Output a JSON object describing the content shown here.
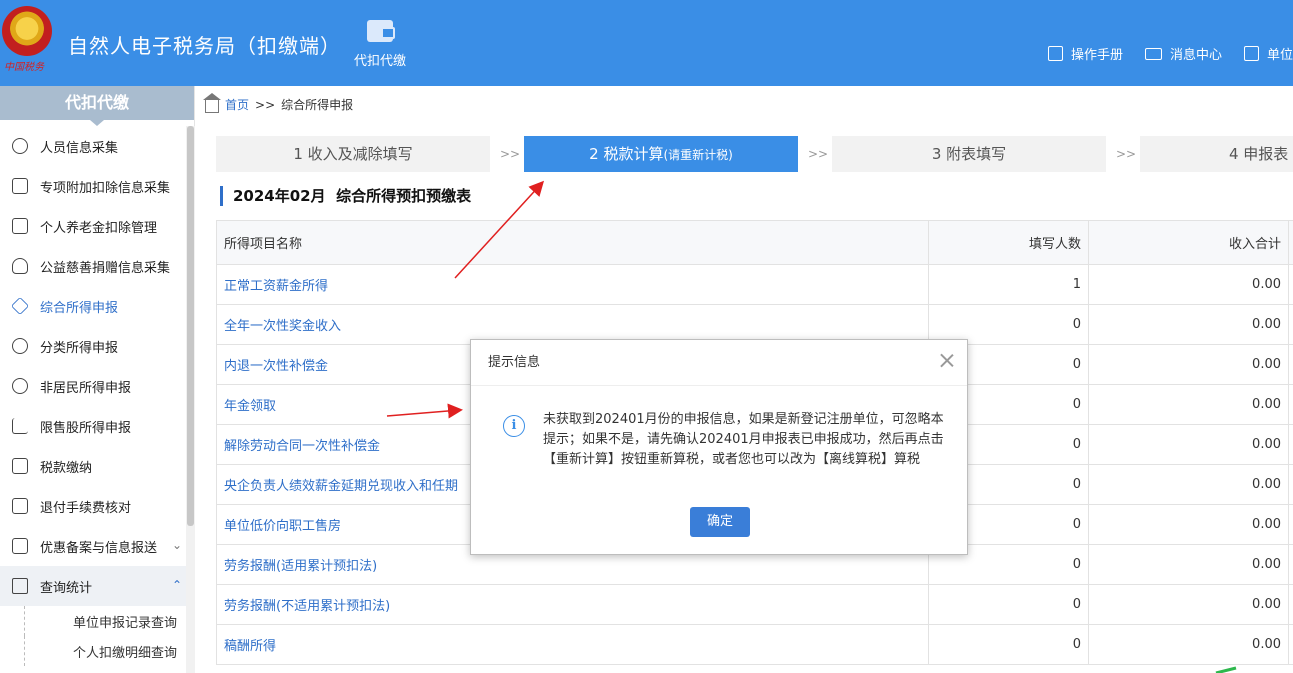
{
  "header": {
    "emblem_text": "中国税务",
    "app_title": "自然人电子税务局（扣缴端）",
    "module_label": "代扣代缴",
    "links": [
      {
        "label": "操作手册",
        "icon": "manual-icon"
      },
      {
        "label": "消息中心",
        "icon": "mail-icon"
      },
      {
        "label": "单位",
        "icon": "building-icon"
      }
    ]
  },
  "sidebar": {
    "title": "代扣代缴",
    "items": [
      {
        "label": "人员信息采集",
        "icon": "person-icon"
      },
      {
        "label": "专项附加扣除信息采集",
        "icon": "list-icon"
      },
      {
        "label": "个人养老金扣除管理",
        "icon": "pension-icon"
      },
      {
        "label": "公益慈善捐赠信息采集",
        "icon": "donation-icon"
      },
      {
        "label": "综合所得申报",
        "icon": "layers-icon"
      },
      {
        "label": "分类所得申报",
        "icon": "pie-icon"
      },
      {
        "label": "非居民所得申报",
        "icon": "user-icon"
      },
      {
        "label": "限售股所得申报",
        "icon": "bars-icon"
      },
      {
        "label": "税款缴纳",
        "icon": "wallet-icon"
      },
      {
        "label": "退付手续费核对",
        "icon": "doc-icon"
      },
      {
        "label": "优惠备案与信息报送",
        "icon": "copy-icon"
      },
      {
        "label": "查询统计",
        "icon": "search-list-icon"
      }
    ],
    "sub_items": [
      "单位申报记录查询",
      "个人扣缴明细查询"
    ]
  },
  "breadcrumb": {
    "home": "首页",
    "separator": ">>",
    "current": "综合所得申报"
  },
  "steps": [
    {
      "label": "1 收入及减除填写",
      "note": ""
    },
    {
      "label": "2 税款计算",
      "note": "(请重新计税)"
    },
    {
      "label": "3 附表填写",
      "note": ""
    },
    {
      "label": "4 申报表",
      "note": ""
    }
  ],
  "step_separator": ">>",
  "sheet": {
    "title": "2024年02月  综合所得预扣预缴表",
    "columns": [
      "所得项目名称",
      "填写人数",
      "收入合计"
    ],
    "rows": [
      {
        "name": "正常工资薪金所得",
        "count": "1",
        "income": "0.00"
      },
      {
        "name": "全年一次性奖金收入",
        "count": "0",
        "income": "0.00"
      },
      {
        "name": "内退一次性补偿金",
        "count": "0",
        "income": "0.00"
      },
      {
        "name": "年金领取",
        "count": "0",
        "income": "0.00"
      },
      {
        "name": "解除劳动合同一次性补偿金",
        "count": "0",
        "income": "0.00"
      },
      {
        "name": "央企负责人绩效薪金延期兑现收入和任期",
        "count": "0",
        "income": "0.00"
      },
      {
        "name": "单位低价向职工售房",
        "count": "0",
        "income": "0.00"
      },
      {
        "name": "劳务报酬(适用累计预扣法)",
        "count": "0",
        "income": "0.00"
      },
      {
        "name": "劳务报酬(不适用累计预扣法)",
        "count": "0",
        "income": "0.00"
      },
      {
        "name": "稿酬所得",
        "count": "0",
        "income": "0.00"
      }
    ]
  },
  "dialog": {
    "title": "提示信息",
    "message": "未获取到202401月份的申报信息，如果是新登记注册单位，可忽略本提示；如果不是，请先确认202401月申报表已申报成功，然后再点击【重新计算】按钮重新算税，或者您也可以改为【离线算税】算税",
    "ok_label": "确定"
  },
  "colors": {
    "brand_blue": "#3a8ee6",
    "link_blue": "#2f6fc9",
    "annotation_red": "#e02020"
  }
}
